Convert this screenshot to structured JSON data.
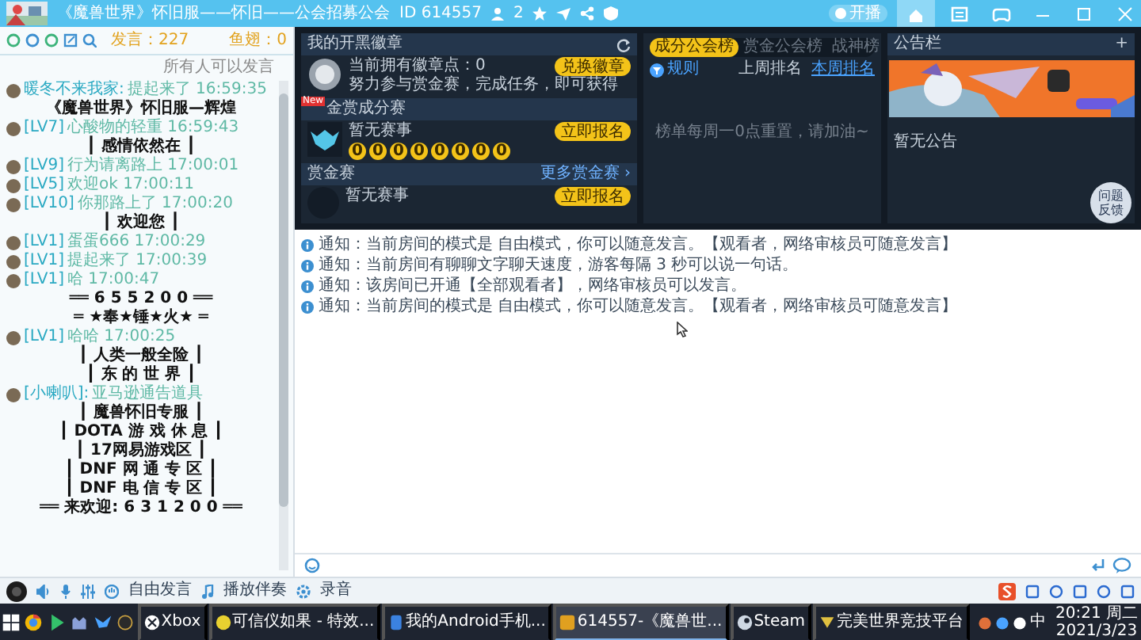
{
  "window": {
    "title": "《魔兽世界》怀旧服——怀旧——公会招募公会",
    "room_id": "ID 614557",
    "viewers": "2",
    "live_toggle": "开播",
    "live_on": false
  },
  "chat_header": {
    "speak_count": "发言：227",
    "fish": "鱼翅：0",
    "permission": "所有人可以发言"
  },
  "chat": [
    {
      "kind": "user",
      "name": "暖冬不来我家:",
      "text": "提起来了 16:59:35"
    },
    {
      "kind": "banner",
      "text": "《魔兽世界》怀旧服—辉煌"
    },
    {
      "kind": "user",
      "name": "[LV7]",
      "text": "心酸物的轻重 16:59:43"
    },
    {
      "kind": "banner",
      "text": "┃ 感情依然在 ┃"
    },
    {
      "kind": "user",
      "name": "[LV9]",
      "text": "行为请离路上 17:00:01"
    },
    {
      "kind": "user",
      "name": "[LV5]",
      "text": "欢迎ok 17:00:11"
    },
    {
      "kind": "user",
      "name": "[LV10]",
      "text": "你那路上了 17:00:20"
    },
    {
      "kind": "banner",
      "text": "┃ 欢迎您 ┃"
    },
    {
      "kind": "user",
      "name": "[LV1]",
      "text": "蛋蛋666 17:00:29"
    },
    {
      "kind": "user",
      "name": "[LV1]",
      "text": "提起来了 17:00:39"
    },
    {
      "kind": "user",
      "name": "[LV1]",
      "text": "哈 17:00:47"
    },
    {
      "kind": "banner",
      "text": "══ 6 5 5 2 0 0 ══"
    },
    {
      "kind": "banner",
      "text": "═ ★奉★锤★火★ ═"
    },
    {
      "kind": "user",
      "name": "[LV1]",
      "text": "哈哈 17:00:25"
    },
    {
      "kind": "banner",
      "text": "┃ 人类一般全险 ┃"
    },
    {
      "kind": "banner",
      "text": "┃ 东 的 世 界 ┃"
    },
    {
      "kind": "user",
      "name": "[小喇叭]:",
      "text": "亚马逊通告道具"
    },
    {
      "kind": "banner",
      "text": "┃ 魔兽怀旧专服 ┃"
    },
    {
      "kind": "banner",
      "text": "┃ DOTA 游 戏 休 息 ┃"
    },
    {
      "kind": "banner",
      "text": "┃ 17网易游戏区 ┃"
    },
    {
      "kind": "banner",
      "text": "┃ DNF 网 通 专 区 ┃"
    },
    {
      "kind": "banner",
      "text": "┃ DNF 电 信 专 区 ┃"
    },
    {
      "kind": "banner",
      "text": "══ 来欢迎: 6 3 1 2 0 0 ══"
    }
  ],
  "badge_panel": {
    "title": "我的开黑徽章",
    "points": "当前拥有徽章点：0",
    "exchange": "兑换徽章",
    "hint": "努力参与赏金赛，完成任务，即可获得",
    "contest_title": "金赏成分赛",
    "new_tag": "New",
    "contest_status": "暂无赛事",
    "signup": "立即报名",
    "digits": [
      "0",
      "0",
      "0",
      "0",
      "0",
      "0",
      "0",
      "0"
    ],
    "bounty_title": "赏金赛",
    "more": "更多赏金赛 ›",
    "bounty_status": "暂无赛事",
    "bounty_signup": "立即报名"
  },
  "ranking": {
    "tabs": [
      {
        "label": "成分公会榜",
        "selected": true
      },
      {
        "label": "赏金公会榜",
        "selected": false
      },
      {
        "label": "战神榜",
        "selected": false
      }
    ],
    "rules": "规则",
    "periods": [
      {
        "label": "上周排名",
        "selected": false
      },
      {
        "label": "本周排名",
        "selected": true
      }
    ],
    "empty": "榜单每周一0点重置，请加油~"
  },
  "notice_board": {
    "title": "公告栏",
    "add": "+",
    "empty": "暂无公告",
    "feedback": "问题反馈"
  },
  "notices": [
    "通知：当前房间的模式是 自由模式，你可以随意发言。【观看者，网络审核员可随意发言】",
    "通知：当前房间有聊聊文字聊天速度，游客每隔 3 秒可以说一句话。",
    "通知：该房间已开通【全部观看者】，网络审核员可以发言。",
    "通知：当前房间的模式是 自由模式，你可以随意发言。【观看者，网络审核员可随意发言】"
  ],
  "toolbar": {
    "free_speech": "自由发言",
    "accompaniment": "播放伴奏",
    "record": "录音"
  },
  "taskbar": {
    "apps": [
      {
        "label": "Xbox",
        "selected": false
      },
      {
        "label": "可信仪如果 - 特效...",
        "selected": false
      },
      {
        "label": "我的Android手机...",
        "selected": false
      },
      {
        "label": "614557-《魔兽世...",
        "selected": true
      },
      {
        "label": "Steam",
        "selected": false
      },
      {
        "label": "完美世界竞技平台",
        "selected": false
      }
    ],
    "ime": "中",
    "time": "20:21 周二",
    "date": "2021/3/23"
  }
}
